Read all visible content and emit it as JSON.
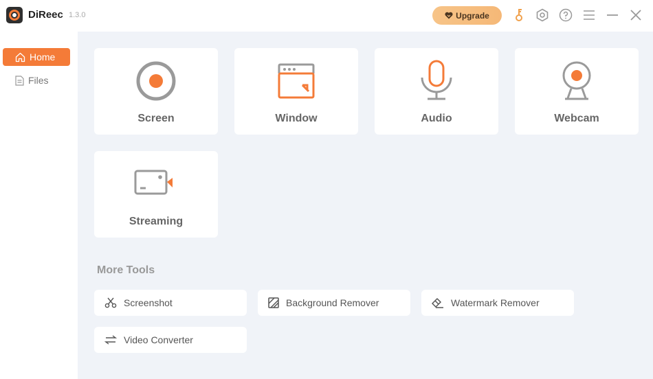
{
  "app": {
    "name": "DiReec",
    "version": "1.3.0"
  },
  "titlebar": {
    "upgrade_label": "Upgrade",
    "icons": [
      "key-icon",
      "settings-icon",
      "help-icon",
      "menu-icon",
      "minimize-icon",
      "close-icon"
    ]
  },
  "sidebar": {
    "items": [
      {
        "label": "Home",
        "icon": "home-icon",
        "active": true
      },
      {
        "label": "Files",
        "icon": "file-icon",
        "active": false
      }
    ]
  },
  "recorders": [
    {
      "label": "Screen",
      "icon": "record-icon"
    },
    {
      "label": "Window",
      "icon": "window-icon"
    },
    {
      "label": "Audio",
      "icon": "microphone-icon"
    },
    {
      "label": "Webcam",
      "icon": "webcam-icon"
    },
    {
      "label": "Streaming",
      "icon": "streaming-camera-icon"
    }
  ],
  "more_tools": {
    "title": "More Tools",
    "items": [
      {
        "label": "Screenshot",
        "icon": "scissors-icon"
      },
      {
        "label": "Background Remover",
        "icon": "background-remover-icon"
      },
      {
        "label": "Watermark Remover",
        "icon": "eraser-icon"
      },
      {
        "label": "Video Converter",
        "icon": "convert-arrows-icon"
      }
    ]
  },
  "colors": {
    "accent": "#f47b38",
    "upgrade": "#f6bf82",
    "background": "#f0f3f8",
    "icon_gray": "#9a9a9a"
  }
}
